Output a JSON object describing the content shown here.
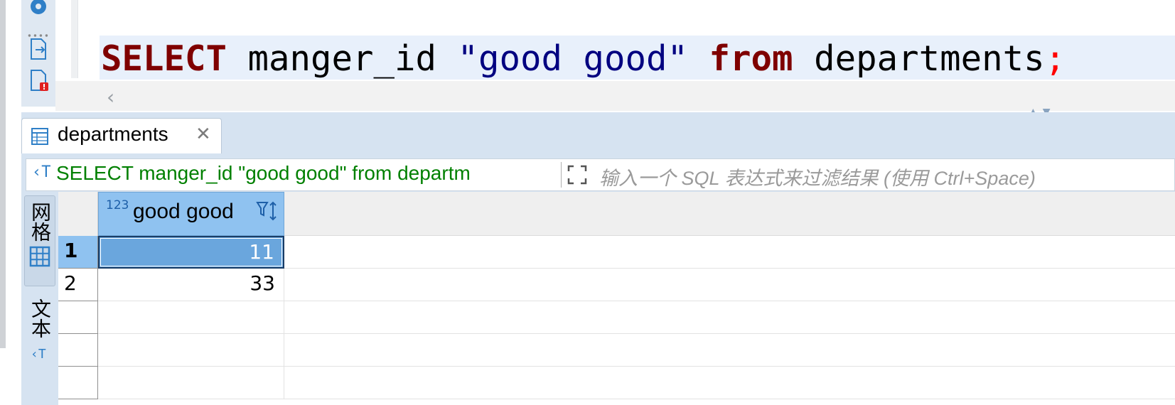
{
  "editor": {
    "sql": {
      "kw_select": "SELECT",
      "col": " manger_id ",
      "alias": "\"good good\"",
      "kw_from": " from",
      "table": " departments",
      "semi": ";"
    },
    "icons": [
      "gear-icon",
      "export-icon",
      "error-file-icon"
    ]
  },
  "results": {
    "tab_label": "departments",
    "filter": {
      "query": "SELECT manger_id \"good good\" from departm",
      "placeholder": "输入一个 SQL 表达式来过滤结果 (使用 Ctrl+Space)"
    },
    "views": {
      "grid_label": "网格",
      "text_label": "文本"
    },
    "grid": {
      "column": {
        "type_badge": "123",
        "name": "good good"
      },
      "rows": [
        {
          "num": "1",
          "value": "11",
          "selected": true
        },
        {
          "num": "2",
          "value": "33",
          "selected": false
        }
      ]
    }
  },
  "colors": {
    "keyword": "#7f0000",
    "string": "#000080",
    "filter_query": "#008000",
    "selection": "#6aa6dd",
    "header": "#8fc2f0"
  }
}
